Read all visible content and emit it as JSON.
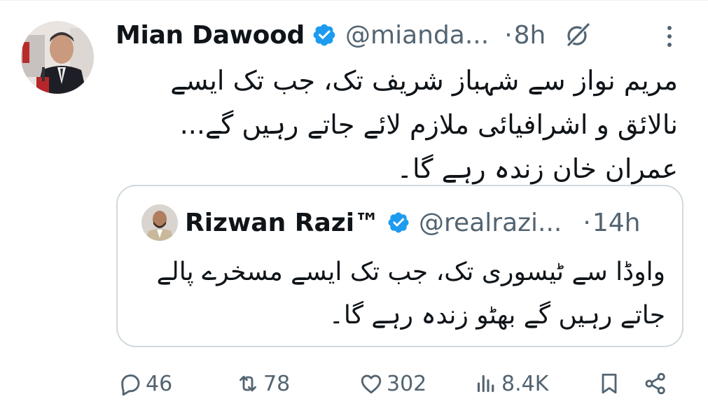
{
  "tweet": {
    "author_name": "Mian Dawood",
    "handle": "@mianda...",
    "separator": "·",
    "time": "8h",
    "text": "مریم نواز سے شہباز شریف تک، جب تک ایسے نالائق و اشرافیائی ملازم لائے جاتے رہیں گے... عمران خان زندہ رہے گا۔"
  },
  "quoted_tweet": {
    "author_name": "Rizwan Razi™",
    "handle": "@realrazi...",
    "separator": "·",
    "time": "14h",
    "text": "واوڈا سے ٹیسوری تک، جب تک ایسے مسخرے پالے جاتے رہیں گے بھٹو زندہ رہے گا۔"
  },
  "actions": {
    "replies": "46",
    "retweets": "78",
    "likes": "302",
    "views": "8.4K"
  },
  "icons": {
    "verified": "verified-badge-icon",
    "grok": "grok-icon",
    "more": "more-icon",
    "reply": "reply-icon",
    "retweet": "retweet-icon",
    "like": "like-icon",
    "views": "views-icon",
    "bookmark": "bookmark-icon",
    "share": "share-icon"
  },
  "colors": {
    "verified_blue": "#1d9bf0",
    "secondary_text": "#536471",
    "border": "#cfd9de"
  }
}
